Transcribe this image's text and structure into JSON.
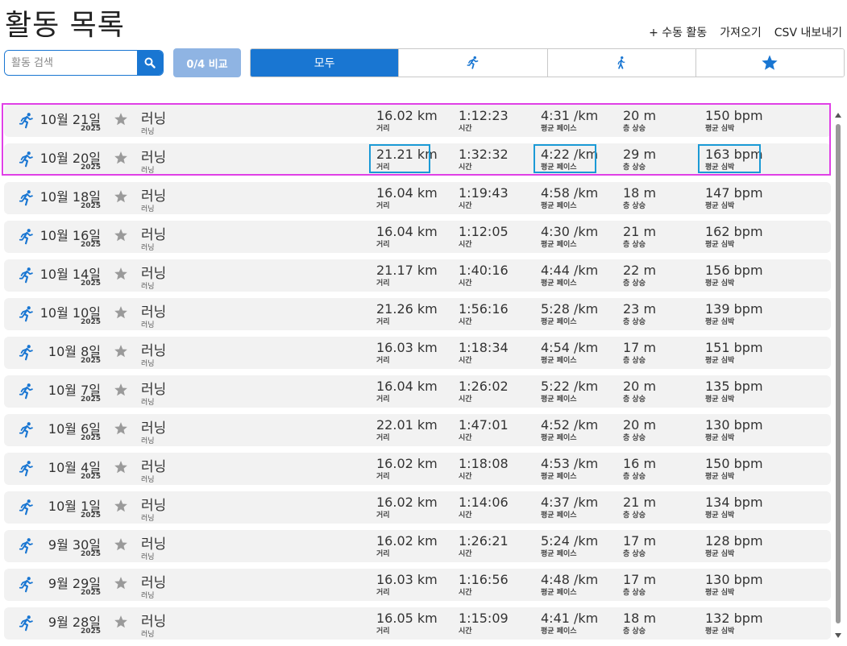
{
  "title": "활동 목록",
  "header_links": {
    "manual": "+ 수동 활동",
    "import": "가져오기",
    "export": "CSV 내보내기"
  },
  "search": {
    "placeholder": "활동 검색",
    "value": ""
  },
  "compare_button": "0/4 비교",
  "filter_tabs": {
    "all": "모두",
    "run_icon": "running-icon",
    "walk_icon": "walking-icon",
    "fav_icon": "star-icon"
  },
  "colors": {
    "accent": "#1976d2",
    "compare_bg": "#8fb4e3",
    "selection": "#e040e6",
    "highlight": "#1b9ad6"
  },
  "labels": {
    "distance": "거리",
    "time": "시간",
    "pace": "평균 페이스",
    "elevation": "층 상승",
    "heart_rate": "평균 심박"
  },
  "activities": [
    {
      "date": "10월 21일",
      "year": "2025",
      "name": "러닝",
      "type": "러닝",
      "distance": "16.02 km",
      "time": "1:12:23",
      "pace": "4:31 /km",
      "elevation": "20 m",
      "heart_rate": "150 bpm"
    },
    {
      "date": "10월 20일",
      "year": "2025",
      "name": "러닝",
      "type": "러닝",
      "distance": "21.21 km",
      "time": "1:32:32",
      "pace": "4:22 /km",
      "elevation": "29 m",
      "heart_rate": "163 bpm"
    },
    {
      "date": "10월 18일",
      "year": "2025",
      "name": "러닝",
      "type": "러닝",
      "distance": "16.04 km",
      "time": "1:19:43",
      "pace": "4:58 /km",
      "elevation": "18 m",
      "heart_rate": "147 bpm"
    },
    {
      "date": "10월 16일",
      "year": "2025",
      "name": "러닝",
      "type": "러닝",
      "distance": "16.04 km",
      "time": "1:12:05",
      "pace": "4:30 /km",
      "elevation": "21 m",
      "heart_rate": "162 bpm"
    },
    {
      "date": "10월 14일",
      "year": "2025",
      "name": "러닝",
      "type": "러닝",
      "distance": "21.17 km",
      "time": "1:40:16",
      "pace": "4:44 /km",
      "elevation": "22 m",
      "heart_rate": "156 bpm"
    },
    {
      "date": "10월 10일",
      "year": "2025",
      "name": "러닝",
      "type": "러닝",
      "distance": "21.26 km",
      "time": "1:56:16",
      "pace": "5:28 /km",
      "elevation": "23 m",
      "heart_rate": "139 bpm"
    },
    {
      "date": "10월 8일",
      "year": "2025",
      "name": "러닝",
      "type": "러닝",
      "distance": "16.03 km",
      "time": "1:18:34",
      "pace": "4:54 /km",
      "elevation": "17 m",
      "heart_rate": "151 bpm"
    },
    {
      "date": "10월 7일",
      "year": "2025",
      "name": "러닝",
      "type": "러닝",
      "distance": "16.04 km",
      "time": "1:26:02",
      "pace": "5:22 /km",
      "elevation": "20 m",
      "heart_rate": "135 bpm"
    },
    {
      "date": "10월 6일",
      "year": "2025",
      "name": "러닝",
      "type": "러닝",
      "distance": "22.01 km",
      "time": "1:47:01",
      "pace": "4:52 /km",
      "elevation": "20 m",
      "heart_rate": "130 bpm"
    },
    {
      "date": "10월 4일",
      "year": "2025",
      "name": "러닝",
      "type": "러닝",
      "distance": "16.02 km",
      "time": "1:18:08",
      "pace": "4:53 /km",
      "elevation": "16 m",
      "heart_rate": "150 bpm"
    },
    {
      "date": "10월 1일",
      "year": "2025",
      "name": "러닝",
      "type": "러닝",
      "distance": "16.02 km",
      "time": "1:14:06",
      "pace": "4:37 /km",
      "elevation": "21 m",
      "heart_rate": "134 bpm"
    },
    {
      "date": "9월 30일",
      "year": "2025",
      "name": "러닝",
      "type": "러닝",
      "distance": "16.02 km",
      "time": "1:26:21",
      "pace": "5:24 /km",
      "elevation": "17 m",
      "heart_rate": "128 bpm"
    },
    {
      "date": "9월 29일",
      "year": "2025",
      "name": "러닝",
      "type": "러닝",
      "distance": "16.03 km",
      "time": "1:16:56",
      "pace": "4:48 /km",
      "elevation": "17 m",
      "heart_rate": "130 bpm"
    },
    {
      "date": "9월 28일",
      "year": "2025",
      "name": "러닝",
      "type": "러닝",
      "distance": "16.05 km",
      "time": "1:15:09",
      "pace": "4:41 /km",
      "elevation": "18 m",
      "heart_rate": "132 bpm"
    }
  ]
}
